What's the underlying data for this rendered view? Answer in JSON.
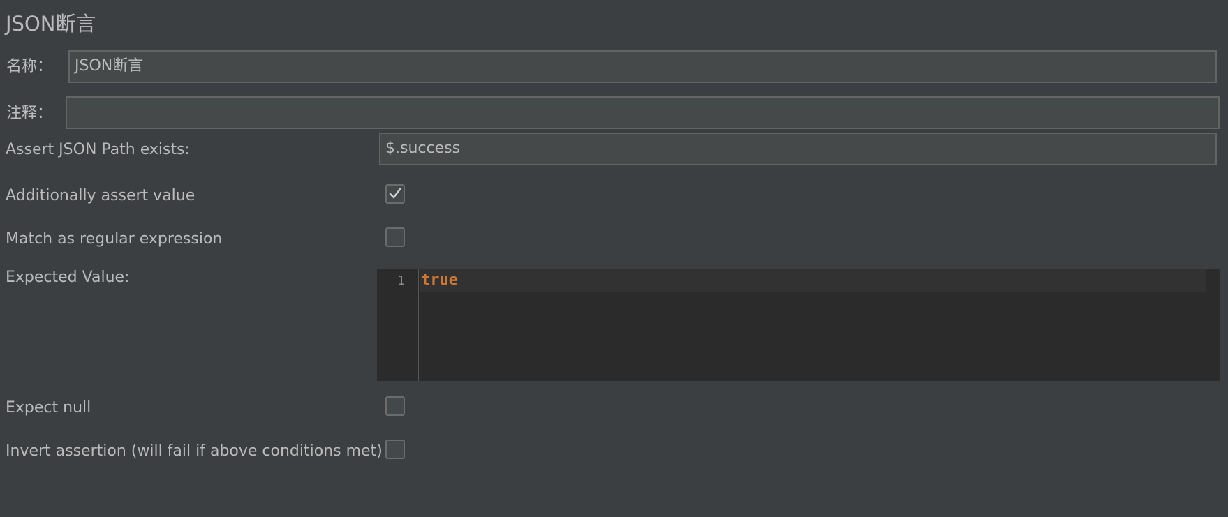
{
  "panel": {
    "title": "JSON断言"
  },
  "form": {
    "name_label": "名称：",
    "name_value": "JSON断言",
    "comment_label": "注释：",
    "comment_value": "",
    "path_label": "Assert JSON Path exists:",
    "path_value": "$.success",
    "assert_value_label": "Additionally assert value",
    "assert_value_checked": true,
    "regex_label": "Match as regular expression",
    "regex_checked": false,
    "expected_label": "Expected Value:",
    "expected_editor": {
      "line_number": "1",
      "code": "true"
    },
    "expect_null_label": "Expect null",
    "expect_null_checked": false,
    "invert_label": "Invert assertion (will fail if above conditions met)",
    "invert_checked": false
  },
  "colors": {
    "background": "#3c3f41",
    "field_bg": "#45494a",
    "editor_bg": "#2b2b2b",
    "keyword": "#cc7832"
  }
}
